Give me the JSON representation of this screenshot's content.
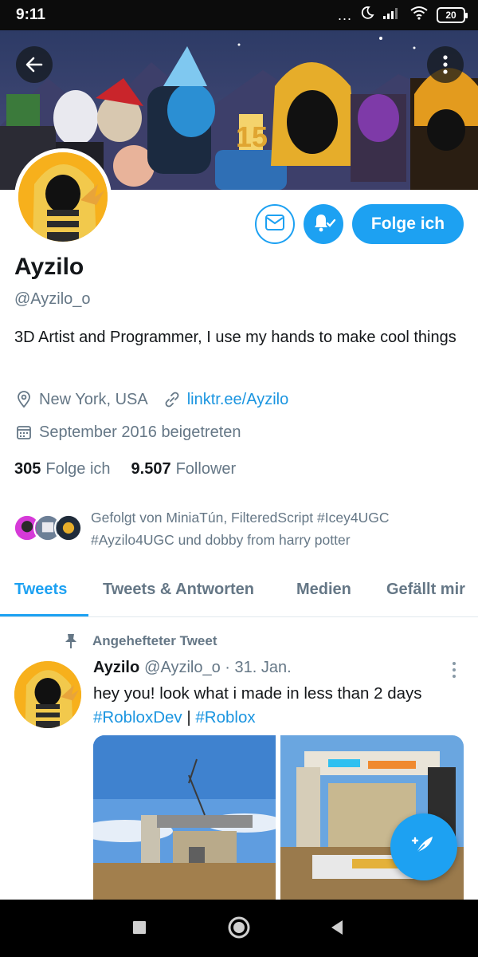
{
  "status_bar": {
    "time": "9:11",
    "overflow_dots": "...",
    "battery": "20"
  },
  "banner": {
    "cake_number": "15"
  },
  "profile": {
    "name": "Ayzilo",
    "handle": "@Ayzilo_o",
    "bio": "3D Artist and Programmer, I use my hands to make cool things",
    "location": "New York, USA",
    "website": "linktr.ee/Ayzilo",
    "joined": "September 2016 beigetreten",
    "following_count": "305",
    "following_label": "Folge ich",
    "followers_count": "9.507",
    "followers_label": "Follower",
    "followed_by": "Gefolgt von MiniaTún, FilteredScript #Icey4UGC #Ayzilo4UGC und dobby from harry potter",
    "follow_button": "Folge ich"
  },
  "tabs": [
    {
      "label": "Tweets",
      "active": true
    },
    {
      "label": "Tweets & Antworten",
      "active": false
    },
    {
      "label": "Medien",
      "active": false
    },
    {
      "label": "Gefällt mir",
      "active": false
    }
  ],
  "tweet": {
    "pinned_label": "Angehefteter Tweet",
    "author": "Ayzilo",
    "handle": "@Ayzilo_o",
    "separator": "·",
    "date": "31. Jan.",
    "text": "hey you! look what i made in less than 2 days",
    "hashtag1": "#RobloxDev",
    "divider": "|",
    "hashtag2": "#Roblox"
  },
  "colors": {
    "accent": "#1da1f2",
    "link": "#1b95e0",
    "secondary_text": "#657786",
    "primary_text": "#14171a"
  },
  "icons": {
    "back": "arrow-left-icon",
    "more": "more-vertical-icon",
    "message": "envelope-icon",
    "notifications": "bell-check-icon",
    "location": "location-pin-icon",
    "link": "link-icon",
    "calendar": "calendar-icon",
    "pin": "pin-icon",
    "compose": "compose-feather-icon"
  }
}
